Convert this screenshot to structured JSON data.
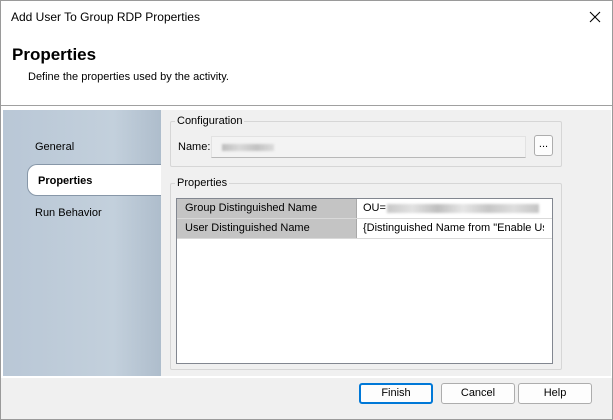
{
  "window": {
    "title": "Add User To Group RDP Properties"
  },
  "header": {
    "title": "Properties",
    "description": "Define the properties used by the activity."
  },
  "sidebar": {
    "items": [
      {
        "label": "General"
      },
      {
        "label": "Properties",
        "selected": true
      },
      {
        "label": "Run Behavior"
      }
    ]
  },
  "configuration": {
    "legend": "Configuration",
    "name_label": "Name:",
    "browse_label": "..."
  },
  "properties": {
    "legend": "Properties",
    "rows": [
      {
        "key": "Group Distinguished Name",
        "value": "OU="
      },
      {
        "key": "User Distinguished Name",
        "value": "{Distinguished Name from \"Enable User\"}"
      }
    ]
  },
  "footer": {
    "finish": "Finish",
    "cancel": "Cancel",
    "help": "Help"
  },
  "colors": {
    "accent": "#0078d7",
    "sidebar": "#c3d0dc",
    "grid_key": "#c4c4c4"
  },
  "icons": {
    "close": "close-icon"
  }
}
